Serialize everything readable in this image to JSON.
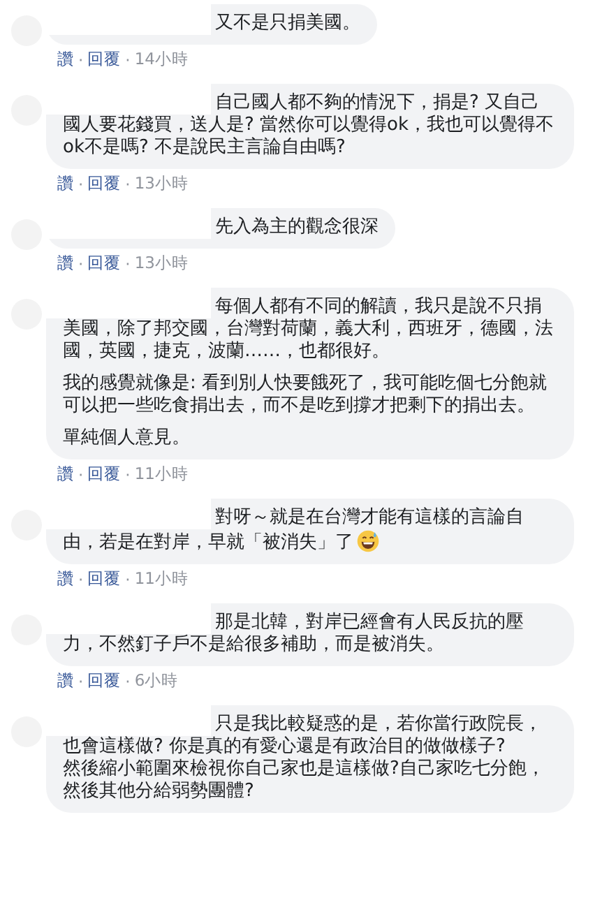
{
  "comments": [
    {
      "paragraphs": [
        [
          "又不是只捐美國。"
        ]
      ],
      "ends_with_emoji": false,
      "actions": [
        {
          "kind": "link",
          "text": "讚"
        },
        {
          "kind": "separator",
          "text": "·"
        },
        {
          "kind": "link",
          "text": "回覆"
        },
        {
          "kind": "separator",
          "text": "·"
        },
        {
          "kind": "time",
          "text": "14小時"
        }
      ]
    },
    {
      "paragraphs": [
        [
          "自己國人都不夠的情況下，捐是? 又自己國人要花錢買，送人是? 當然你可以覺得ok，我也可以覺得不ok不是嗎? 不是說民主言論自由嗎?"
        ]
      ],
      "ends_with_emoji": false,
      "actions": [
        {
          "kind": "link",
          "text": "讚"
        },
        {
          "kind": "separator",
          "text": "·"
        },
        {
          "kind": "link",
          "text": "回覆"
        },
        {
          "kind": "separator",
          "text": "·"
        },
        {
          "kind": "time",
          "text": "13小時"
        }
      ]
    },
    {
      "paragraphs": [
        [
          "先入為主的觀念很深"
        ]
      ],
      "ends_with_emoji": false,
      "actions": [
        {
          "kind": "link",
          "text": "讚"
        },
        {
          "kind": "separator",
          "text": "·"
        },
        {
          "kind": "link",
          "text": "回覆"
        },
        {
          "kind": "separator",
          "text": "·"
        },
        {
          "kind": "time",
          "text": "13小時"
        }
      ]
    },
    {
      "paragraphs": [
        [
          "每個人都有不同的解讀，我只是說不只捐美國，除了邦交國，台灣對荷蘭，義大利，西班牙，德國，法國，英國，捷克，波蘭……，也都很好。"
        ],
        [
          "我的感覺就像是: 看到別人快要餓死了，我可能吃個七分飽就可以把一些吃食捐出去，而不是吃到撐才把剩下的捐出去。"
        ],
        [
          "單純個人意見。"
        ]
      ],
      "ends_with_emoji": false,
      "actions": [
        {
          "kind": "link",
          "text": "讚"
        },
        {
          "kind": "separator",
          "text": "·"
        },
        {
          "kind": "link",
          "text": "回覆"
        },
        {
          "kind": "separator",
          "text": "·"
        },
        {
          "kind": "time",
          "text": "11小時"
        }
      ]
    },
    {
      "paragraphs": [
        [
          "對呀～就是在台灣才能有這樣的言論自由，若是在對岸，早就「被消失」了"
        ]
      ],
      "ends_with_emoji": true,
      "actions": [
        {
          "kind": "link",
          "text": "讚"
        },
        {
          "kind": "separator",
          "text": "·"
        },
        {
          "kind": "link",
          "text": "回覆"
        },
        {
          "kind": "separator",
          "text": "·"
        },
        {
          "kind": "time",
          "text": "11小時"
        }
      ]
    },
    {
      "paragraphs": [
        [
          "那是北韓，對岸已經會有人民反抗的壓力，不然釘子戶不是給很多補助，而是被消失。"
        ]
      ],
      "ends_with_emoji": false,
      "actions": [
        {
          "kind": "link",
          "text": "讚"
        },
        {
          "kind": "separator",
          "text": "·"
        },
        {
          "kind": "link",
          "text": "回覆"
        },
        {
          "kind": "separator",
          "text": "·"
        },
        {
          "kind": "time",
          "text": "6小時"
        }
      ]
    },
    {
      "paragraphs": [
        [
          "只是我比較疑惑的是，若你當行政院長，也會這樣做? 你是真的有愛心還是有政治目的做做樣子?",
          "然後縮小範圍來檢視你自己家也是這樣做?自己家吃七分飽，然後其他分給弱勢團體?"
        ]
      ],
      "ends_with_emoji": false
    }
  ]
}
